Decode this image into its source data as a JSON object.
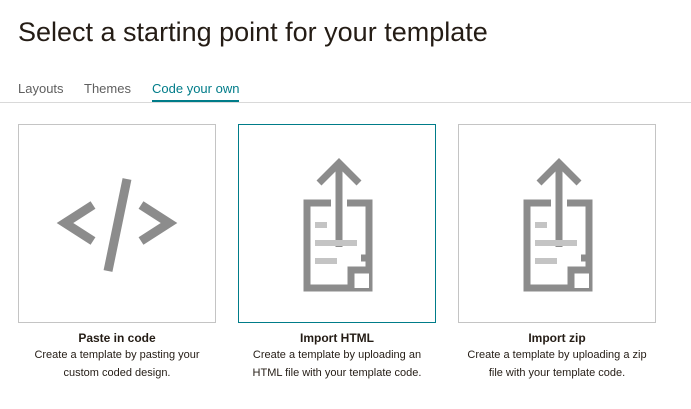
{
  "page": {
    "title": "Select a starting point for your template"
  },
  "tabs": [
    {
      "label": "Layouts",
      "active": false
    },
    {
      "label": "Themes",
      "active": false
    },
    {
      "label": "Code your own",
      "active": true
    }
  ],
  "colors": {
    "accent": "#007c89",
    "icon_gray": "#8c8c8c",
    "card_border": "#c4c4c4",
    "text": "#241c15"
  },
  "options": [
    {
      "title": "Paste in code",
      "description": "Create a template by pasting your custom coded design.",
      "icon": "code-brackets-icon",
      "selected": false
    },
    {
      "title": "Import HTML",
      "description": "Create a template by uploading an HTML file with your template code.",
      "icon": "upload-document-icon",
      "selected": true
    },
    {
      "title": "Import zip",
      "description": "Create a template by uploading a zip file with your template code.",
      "icon": "upload-document-icon",
      "selected": false
    }
  ]
}
